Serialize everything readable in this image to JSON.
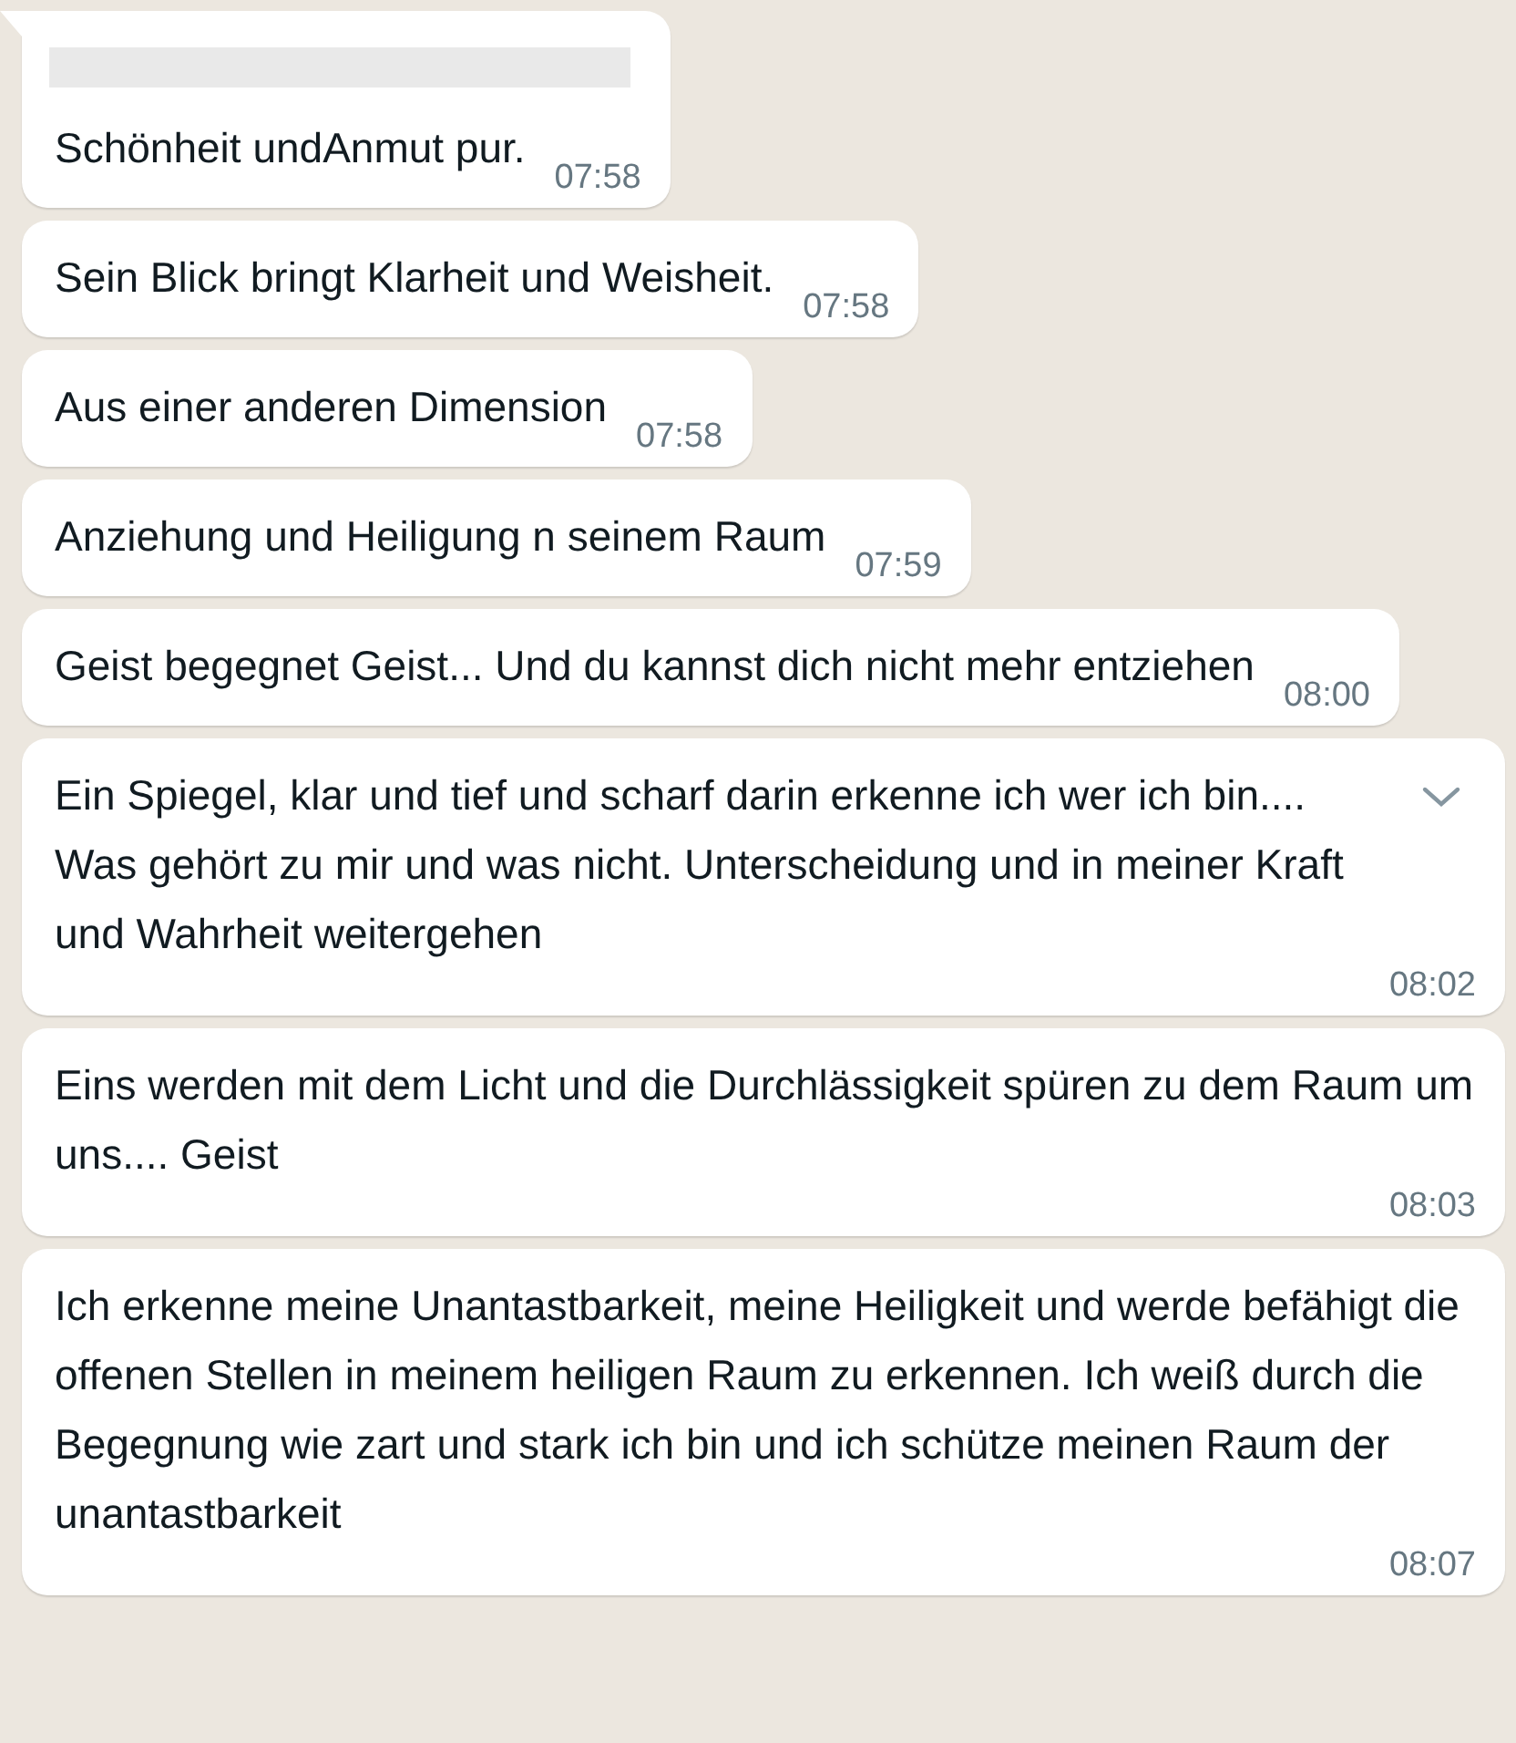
{
  "messages": [
    {
      "text": "Schönheit undAnmut pur.",
      "time": "07:58",
      "sender_redacted": true,
      "tail": true,
      "menu_caret": false
    },
    {
      "text": "Sein Blick bringt Klarheit und Weisheit.",
      "time": "07:58",
      "sender_redacted": false,
      "tail": false,
      "menu_caret": false
    },
    {
      "text": "Aus einer anderen Dimension",
      "time": "07:58",
      "sender_redacted": false,
      "tail": false,
      "menu_caret": false
    },
    {
      "text": "Anziehung und Heiligung n seinem Raum",
      "time": "07:59",
      "sender_redacted": false,
      "tail": false,
      "menu_caret": false
    },
    {
      "text": "Geist begegnet Geist... Und du kannst dich nicht mehr entziehen",
      "time": "08:00",
      "sender_redacted": false,
      "tail": false,
      "menu_caret": false
    },
    {
      "text": "Ein Spiegel, klar und tief und scharf darin erkenne ich wer ich bin.... Was gehört zu mir und was nicht. Unterscheidung und in meiner Kraft und Wahrheit weitergehen",
      "time": "08:02",
      "sender_redacted": false,
      "tail": false,
      "menu_caret": true
    },
    {
      "text": "Eins werden mit dem Licht und die Durchlässigkeit spüren zu dem Raum um uns.... Geist",
      "time": "08:03",
      "sender_redacted": false,
      "tail": false,
      "menu_caret": false
    },
    {
      "text": "Ich erkenne meine Unantastbarkeit, meine Heiligkeit und werde befähigt die offenen Stellen in meinem heiligen Raum zu erkennen. Ich weiß durch die Begegnung wie zart und stark ich bin und ich schütze meinen Raum der unantastbarkeit",
      "time": "08:07",
      "sender_redacted": false,
      "tail": false,
      "menu_caret": false
    }
  ]
}
